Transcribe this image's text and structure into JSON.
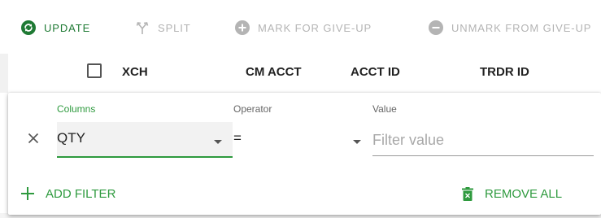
{
  "toolbar": {
    "update_label": "UPDATE",
    "split_label": "SPLIT",
    "mark_label": "MARK FOR GIVE-UP",
    "unmark_label": "UNMARK FROM GIVE-UP",
    "enabled_color": "#1f7a34",
    "disabled_color": "#b4b4b4"
  },
  "grid": {
    "columns": [
      "XCH",
      "CM ACCT",
      "ACCT ID",
      "TRDR ID"
    ]
  },
  "filter": {
    "columns_label": "Columns",
    "operator_label": "Operator",
    "value_label": "Value",
    "column_value": "QTY",
    "operator_value": "=",
    "value_placeholder": "Filter value",
    "accent_color": "#2e9a3e"
  },
  "actions": {
    "add_filter": "ADD FILTER",
    "remove_all": "REMOVE ALL"
  },
  "icons": {
    "update": "sync-circle-icon",
    "split": "split-arrows-icon",
    "mark": "plus-circle-icon",
    "unmark": "minus-circle-icon",
    "remove_filter": "close-icon",
    "add_filter": "plus-icon",
    "remove_all": "trash-icon"
  }
}
